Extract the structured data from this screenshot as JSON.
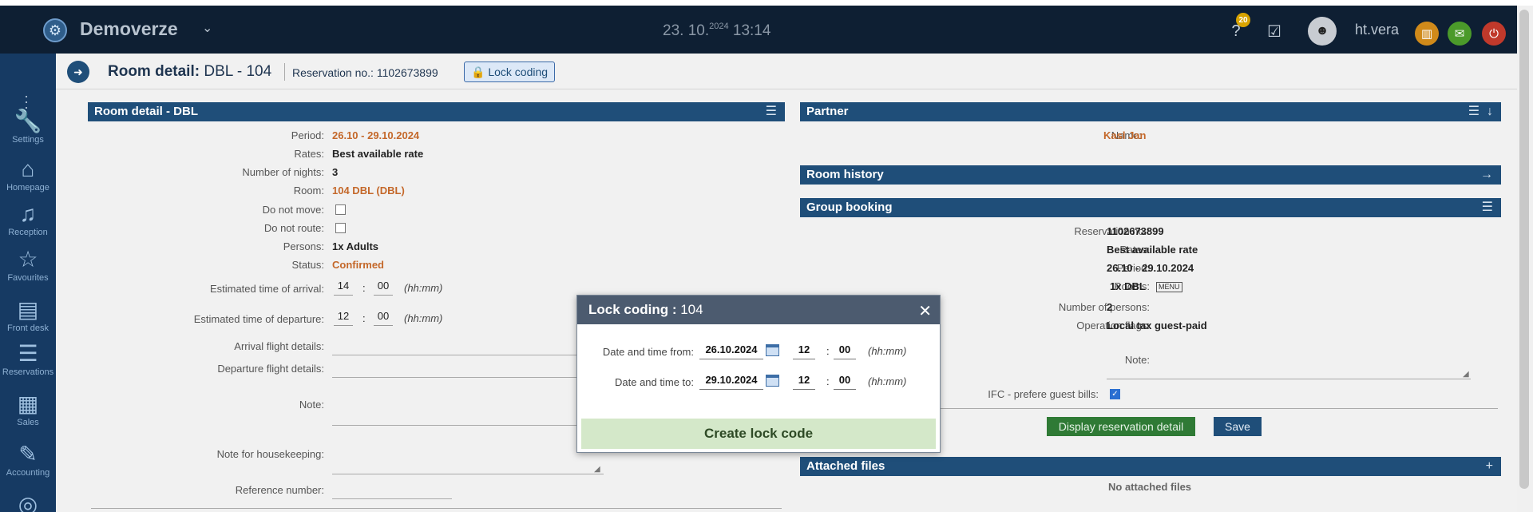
{
  "header": {
    "hotel_name": "Demoverze",
    "clock_date": "23. 10.",
    "clock_year": "2024",
    "clock_time": "13:14",
    "notification_count": "20",
    "username": "ht.vera"
  },
  "sidebar": {
    "items": [
      {
        "label": "Settings",
        "icon": "wrench-icon",
        "glyph": "🔧"
      },
      {
        "label": "Homepage",
        "icon": "home-icon",
        "glyph": "⌂"
      },
      {
        "label": "Reception",
        "icon": "bell-icon",
        "glyph": "🛎"
      },
      {
        "label": "Favourites",
        "icon": "star-icon",
        "glyph": "☆"
      },
      {
        "label": "Front desk",
        "icon": "front-desk-icon",
        "glyph": "▤"
      },
      {
        "label": "Reservations",
        "icon": "sliders-icon",
        "glyph": "☰"
      },
      {
        "label": "Sales",
        "icon": "calculator-icon",
        "glyph": "▦"
      },
      {
        "label": "Accounting",
        "icon": "accounting-icon",
        "glyph": "✎"
      }
    ]
  },
  "subheader": {
    "title_bold": "Room detail:",
    "title_rest": " DBL - 104",
    "reservation_label": "Reservation no.: 1102673899",
    "lock_badge": "Lock coding"
  },
  "room_panel": {
    "title": "Room detail - DBL",
    "period_label": "Period:",
    "period_value": "26.10 - 29.10.2024",
    "rates_label": "Rates:",
    "rates_value": "Best available rate",
    "nights_label": "Number of nights:",
    "nights_value": "3",
    "room_label": "Room:",
    "room_value": "104 DBL (DBL)",
    "do_not_move_label": "Do not move:",
    "do_not_route_label": "Do not route:",
    "persons_label": "Persons:",
    "persons_value": "1x Adults",
    "status_label": "Status:",
    "status_value": "Confirmed",
    "eta_label": "Estimated time of arrival:",
    "eta_h": "14",
    "eta_m": "00",
    "etd_label": "Estimated time of departure:",
    "etd_h": "12",
    "etd_m": "00",
    "hhmm": "(hh:mm)",
    "arrival_flight_label": "Arrival flight details:",
    "departure_flight_label": "Departure flight details:",
    "note_label": "Note:",
    "housekeeping_label": "Note for housekeeping:",
    "reference_label": "Reference number:"
  },
  "partner_panel": {
    "title": "Partner",
    "name_label": "Name:",
    "name_value": "Kasl Jan"
  },
  "history_panel": {
    "title": "Room history"
  },
  "group_panel": {
    "title": "Group booking",
    "resno_label": "Reservation no.:",
    "resno_value": "1102673899",
    "rates_label": "Rates:",
    "rates_value": "Best available rate",
    "period_label": "Period:",
    "period_value": "26.10 - 29.10.2024",
    "rooms_label": "Rooms:",
    "rooms_value": "1x DBL",
    "rooms_menu": "MENU",
    "persons_label": "Number of persons:",
    "persons_value": "2",
    "flags_label": "Operation flags:",
    "flags_value": "Local tax guest-paid",
    "note_label": "Note:",
    "ifc_label": "IFC - prefere guest bills:",
    "display_btn": "Display reservation detail",
    "save_btn": "Save"
  },
  "files_panel": {
    "title": "Attached files",
    "empty_text": "No attached files"
  },
  "modal": {
    "title_bold": "Lock coding :",
    "title_rest": " 104",
    "from_label": "Date and time from:",
    "from_date": "26.10.2024",
    "from_h": "12",
    "from_m": "00",
    "to_label": "Date and time to:",
    "to_date": "29.10.2024",
    "to_h": "12",
    "to_m": "00",
    "hhmm": "(hh:mm)",
    "create_btn": "Create lock code"
  }
}
